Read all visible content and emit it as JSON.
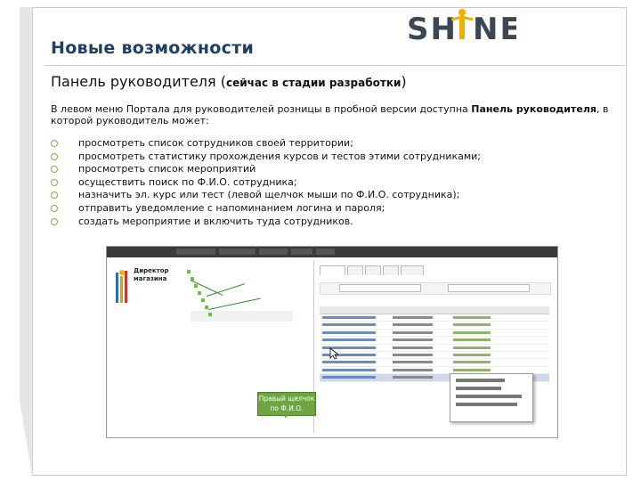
{
  "slide": {
    "title": "Новые возможности",
    "logo_text": "SH NE",
    "subtitle_main": "Панель руководителя (",
    "subtitle_small": "сейчас в стадии разработки",
    "subtitle_end": ")",
    "intro_part1": "В левом меню Портала для руководителей розницы в пробной версии доступна ",
    "intro_bold": "Панель руководителя",
    "intro_part2": ", в которой руководитель может:",
    "bullets": [
      "просмотреть список сотрудников своей территории;",
      "просмотреть статистику прохождения курсов и тестов этими сотрудниками;",
      "просмотреть список мероприятий",
      "осуществить поиск по Ф.И.О. сотрудника;",
      "назначить эл. курс или тест (левой щелчок мыши по Ф.И.О. сотрудника);",
      "отправить уведомление с напоминанием логина и пароля;",
      "создать мероприятие и включить туда сотрудников."
    ],
    "callout": "Правый щелчок по Ф.И.О."
  },
  "screenshot": {
    "director_label": "Директор магазина",
    "colors": {
      "accent_green": "#6fa443",
      "title_blue": "#1f3f66",
      "tab_orange": "#e07a00"
    },
    "table_rows": 10,
    "selected_row": 9
  }
}
